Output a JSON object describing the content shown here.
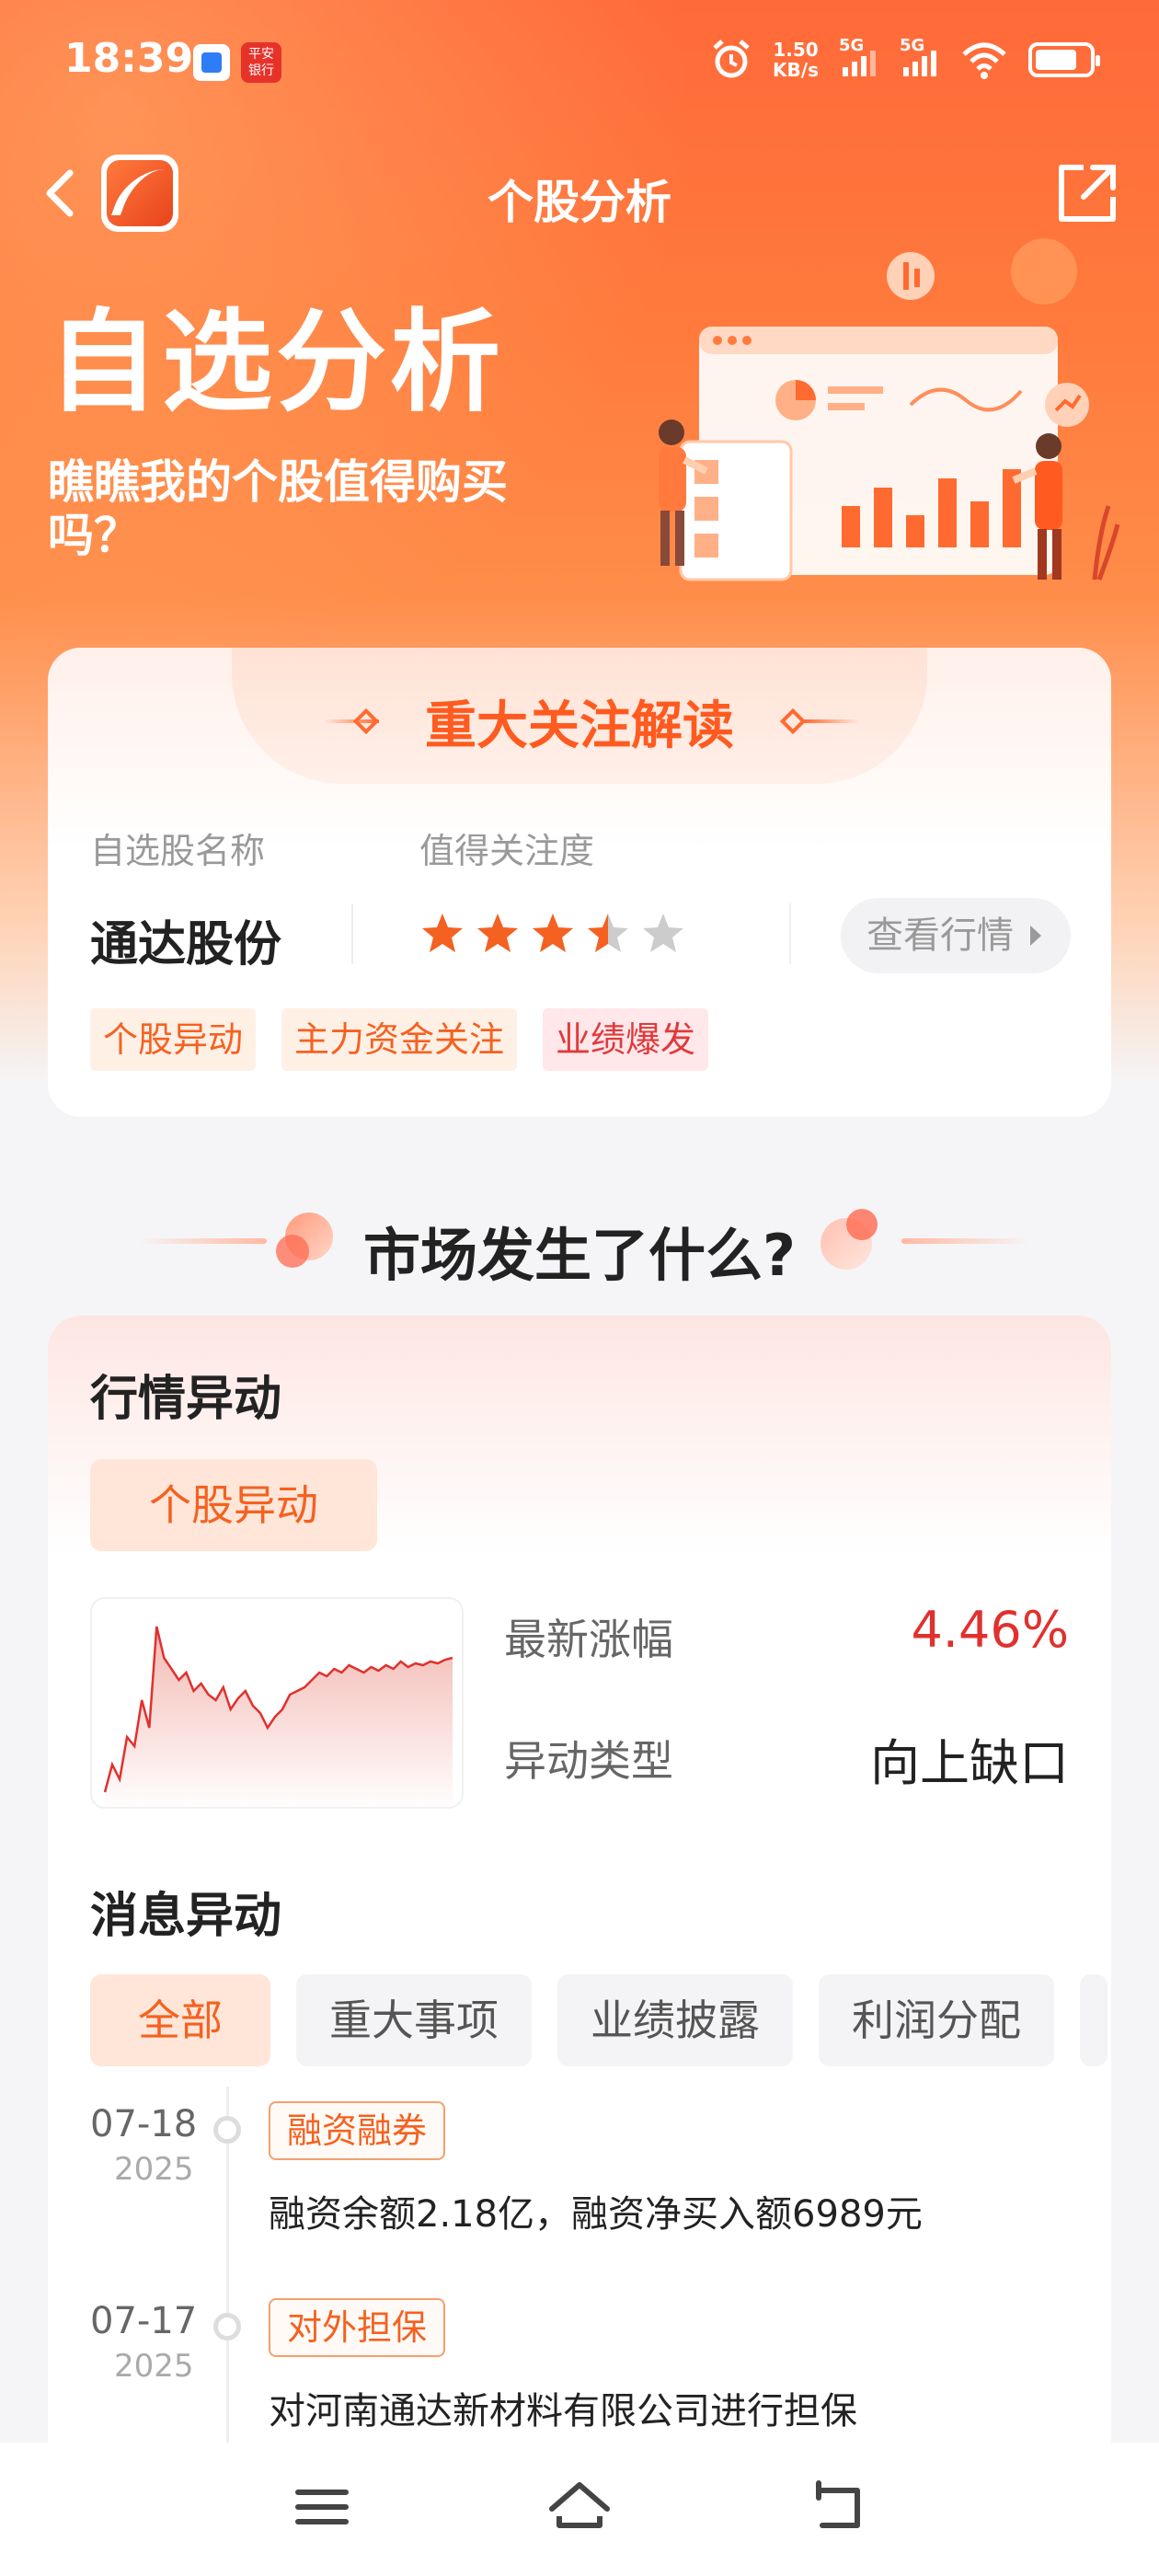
{
  "status_bar": {
    "time": "18:39",
    "net_speed_value": "1.50",
    "net_speed_unit": "KB/s",
    "signal1": "5G",
    "signal2": "5G",
    "app2_label_line1": "平安",
    "app2_label_line2": "银行"
  },
  "nav": {
    "title": "个股分析"
  },
  "hero": {
    "title": "自选分析",
    "subtitle": "瞧瞧我的个股值得购买吗？"
  },
  "focus_card": {
    "header": "重大关注解读",
    "col_name_label": "自选股名称",
    "col_attention_label": "值得关注度",
    "stock_name": "通达股份",
    "attention_rating": 3.5,
    "attention_max": 5,
    "view_button": "查看行情",
    "tags": [
      {
        "label": "个股异动",
        "style": "orange"
      },
      {
        "label": "主力资金关注",
        "style": "orange"
      },
      {
        "label": "业绩爆发",
        "style": "red"
      }
    ]
  },
  "market_section": {
    "title": "市场发生了什么?"
  },
  "market_card": {
    "title": "行情异动",
    "chip": "个股异动",
    "latest_change_label": "最新涨幅",
    "latest_change_value": "4.46%",
    "move_type_label": "异动类型",
    "move_type_value": "向上缺口",
    "sparkline": [
      0.05,
      0.2,
      0.12,
      0.35,
      0.3,
      0.55,
      0.4,
      0.95,
      0.78,
      0.72,
      0.66,
      0.7,
      0.6,
      0.64,
      0.58,
      0.55,
      0.62,
      0.5,
      0.56,
      0.6,
      0.52,
      0.48,
      0.4,
      0.46,
      0.5,
      0.58,
      0.6,
      0.62,
      0.66,
      0.7,
      0.68,
      0.72,
      0.7,
      0.74,
      0.72,
      0.7,
      0.73,
      0.71,
      0.74,
      0.72,
      0.76,
      0.73,
      0.75,
      0.74,
      0.76,
      0.75,
      0.77,
      0.78
    ],
    "colors": {
      "up": "#e0312e",
      "accent": "#f56120"
    }
  },
  "messages": {
    "title": "消息异动",
    "filters": [
      "全部",
      "重大事项",
      "业绩披露",
      "利润分配"
    ],
    "items": [
      {
        "date": "07-18",
        "year": "2025",
        "tag": "融资融券",
        "text": "融资余额2.18亿，融资净买入额6989元"
      },
      {
        "date": "07-17",
        "year": "2025",
        "tag": "对外担保",
        "text": "对河南通达新材料有限公司进行担保"
      }
    ]
  },
  "icons": {
    "back": "back-chevron-icon",
    "share": "share-icon",
    "menu": "menu-icon",
    "home": "home-icon",
    "return": "return-icon"
  }
}
